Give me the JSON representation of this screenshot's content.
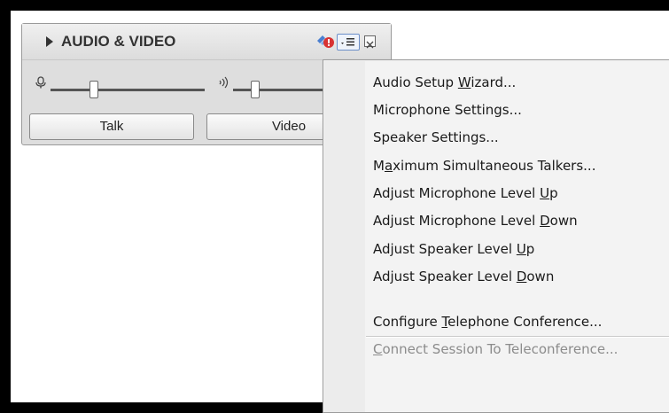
{
  "panel": {
    "title": "AUDIO & VIDEO",
    "talk_label": "Talk",
    "video_label": "Video",
    "status_icon": "network-warning-icon",
    "menu_icon": "options-menu-icon",
    "close_icon": "close-icon",
    "microphone_icon": "microphone-icon",
    "speaker_icon": "speaker-icon",
    "microphone_level": 0.28,
    "speaker_level": 0.18
  },
  "menu": {
    "items": [
      {
        "pre": "Audio Setup ",
        "key": "W",
        "post": "izard...",
        "enabled": true
      },
      {
        "pre": "Microphone Settings...",
        "key": "",
        "post": "",
        "enabled": true
      },
      {
        "pre": "Speaker Settings...",
        "key": "",
        "post": "",
        "enabled": true
      },
      {
        "pre": "M",
        "key": "a",
        "post": "ximum Simultaneous Talkers...",
        "enabled": true
      },
      {
        "pre": "Adjust Microphone Level ",
        "key": "U",
        "post": "p",
        "enabled": true
      },
      {
        "pre": "Adjust Microphone Level ",
        "key": "D",
        "post": "own",
        "enabled": true
      },
      {
        "pre": "Adjust Speaker Level ",
        "key": "U",
        "post": "p",
        "enabled": true
      },
      {
        "pre": "Adjust Speaker Level ",
        "key": "D",
        "post": "own",
        "enabled": true
      },
      {
        "pre": "Configure ",
        "key": "T",
        "post": "elephone Conference...",
        "enabled": true
      },
      {
        "pre": "",
        "key": "C",
        "post": "onnect Session To Teleconference...",
        "enabled": false
      }
    ]
  },
  "colors": {
    "panel_bg": "#dedede",
    "menu_bg": "#f3f3f3",
    "menu_highlight_border": "#6c8fc9",
    "disabled_text": "#8c8c8c"
  }
}
